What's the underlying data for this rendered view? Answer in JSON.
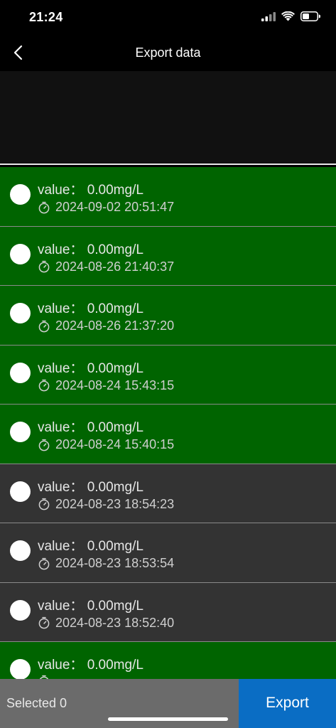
{
  "status_bar": {
    "time": "21:24",
    "icons": [
      "cellular-signal-icon",
      "wifi-icon",
      "battery-icon"
    ]
  },
  "nav": {
    "title": "Export data",
    "back_icon": "chevron-left-icon"
  },
  "colors": {
    "row_green": "#006400",
    "row_gray": "#333333",
    "export_blue": "#0a6dc4",
    "selected_bar": "#6b6b6b"
  },
  "records": [
    {
      "value": "value： 0.00mg/L",
      "time": "2024-09-02 20:51:47",
      "color": "green"
    },
    {
      "value": "value： 0.00mg/L",
      "time": "2024-08-26 21:40:37",
      "color": "green"
    },
    {
      "value": "value： 0.00mg/L",
      "time": "2024-08-26 21:37:20",
      "color": "green"
    },
    {
      "value": "value： 0.00mg/L",
      "time": "2024-08-24 15:43:15",
      "color": "green"
    },
    {
      "value": "value： 0.00mg/L",
      "time": "2024-08-24 15:40:15",
      "color": "green"
    },
    {
      "value": "value： 0.00mg/L",
      "time": "2024-08-23 18:54:23",
      "color": "gray"
    },
    {
      "value": "value： 0.00mg/L",
      "time": "2024-08-23 18:53:54",
      "color": "gray"
    },
    {
      "value": "value： 0.00mg/L",
      "time": "2024-08-23 18:52:40",
      "color": "gray"
    },
    {
      "value": "value： 0.00mg/L",
      "time": "",
      "color": "green"
    }
  ],
  "bottom": {
    "selected_label": "Selected 0",
    "export_label": "Export"
  }
}
